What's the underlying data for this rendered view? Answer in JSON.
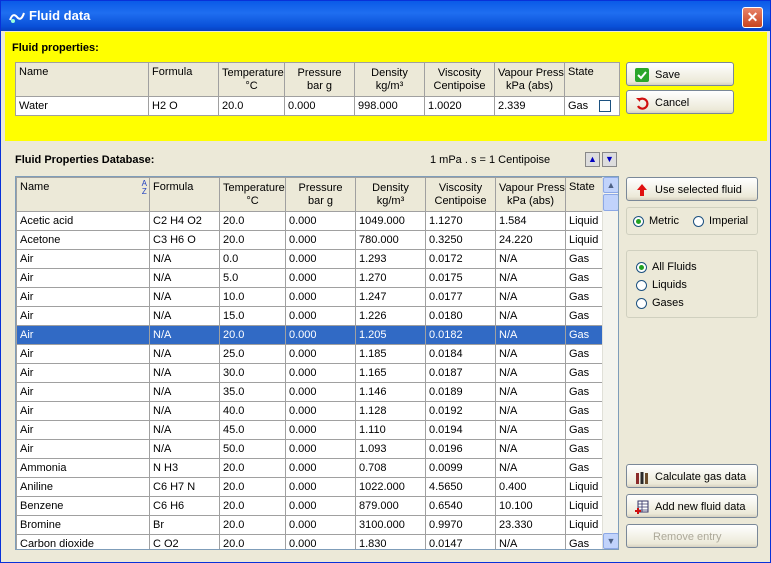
{
  "window": {
    "title": "Fluid data",
    "close_glyph": "✕"
  },
  "fluid_properties": {
    "label": "Fluid properties:",
    "headers": [
      "Name",
      "Formula",
      "Temperature\n°C",
      "Pressure\nbar g",
      "Density\nkg/m³",
      "Viscosity\nCentipoise",
      "Vapour Press.\nkPa (abs)",
      "State"
    ],
    "row": {
      "name": "Water",
      "formula": "H2 O",
      "temperature": "20.0",
      "pressure": "0.000",
      "density": "998.000",
      "viscosity": "1.0020",
      "vapour": "2.339",
      "state": "Gas"
    }
  },
  "buttons": {
    "save": "Save",
    "cancel": "Cancel",
    "use_selected": "Use selected fluid",
    "calculate_gas": "Calculate gas data",
    "add_new": "Add new fluid data",
    "remove": "Remove entry"
  },
  "units": {
    "metric": "Metric",
    "imperial": "Imperial",
    "selected": "Metric"
  },
  "filter": {
    "all": "All Fluids",
    "liquids": "Liquids",
    "gases": "Gases",
    "selected": "All Fluids"
  },
  "database": {
    "label": "Fluid Properties Database:",
    "note": "1 mPa . s = 1 Centipoise",
    "sort_glyph_top": "A",
    "sort_glyph_bottom": "Z",
    "headers": [
      "Name",
      "Formula",
      "Temperature\n°C",
      "Pressure\nbar g",
      "Density\nkg/m³",
      "Viscosity\nCentipoise",
      "Vapour Press.\nkPa (abs)",
      "State"
    ],
    "selected_index": 6,
    "rows": [
      [
        "Acetic acid",
        "C2 H4 O2",
        "20.0",
        "0.000",
        "1049.000",
        "1.1270",
        "1.584",
        "Liquid"
      ],
      [
        "Acetone",
        "C3 H6 O",
        "20.0",
        "0.000",
        "780.000",
        "0.3250",
        "24.220",
        "Liquid"
      ],
      [
        "Air",
        "N/A",
        "0.0",
        "0.000",
        "1.293",
        "0.0172",
        "N/A",
        "Gas"
      ],
      [
        "Air",
        "N/A",
        "5.0",
        "0.000",
        "1.270",
        "0.0175",
        "N/A",
        "Gas"
      ],
      [
        "Air",
        "N/A",
        "10.0",
        "0.000",
        "1.247",
        "0.0177",
        "N/A",
        "Gas"
      ],
      [
        "Air",
        "N/A",
        "15.0",
        "0.000",
        "1.226",
        "0.0180",
        "N/A",
        "Gas"
      ],
      [
        "Air",
        "N/A",
        "20.0",
        "0.000",
        "1.205",
        "0.0182",
        "N/A",
        "Gas"
      ],
      [
        "Air",
        "N/A",
        "25.0",
        "0.000",
        "1.185",
        "0.0184",
        "N/A",
        "Gas"
      ],
      [
        "Air",
        "N/A",
        "30.0",
        "0.000",
        "1.165",
        "0.0187",
        "N/A",
        "Gas"
      ],
      [
        "Air",
        "N/A",
        "35.0",
        "0.000",
        "1.146",
        "0.0189",
        "N/A",
        "Gas"
      ],
      [
        "Air",
        "N/A",
        "40.0",
        "0.000",
        "1.128",
        "0.0192",
        "N/A",
        "Gas"
      ],
      [
        "Air",
        "N/A",
        "45.0",
        "0.000",
        "1.110",
        "0.0194",
        "N/A",
        "Gas"
      ],
      [
        "Air",
        "N/A",
        "50.0",
        "0.000",
        "1.093",
        "0.0196",
        "N/A",
        "Gas"
      ],
      [
        "Ammonia",
        "N H3",
        "20.0",
        "0.000",
        "0.708",
        "0.0099",
        "N/A",
        "Gas"
      ],
      [
        "Aniline",
        "C6 H7 N",
        "20.0",
        "0.000",
        "1022.000",
        "4.5650",
        "0.400",
        "Liquid"
      ],
      [
        "Benzene",
        "C6 H6",
        "20.0",
        "0.000",
        "879.000",
        "0.6540",
        "10.100",
        "Liquid"
      ],
      [
        "Bromine",
        "Br",
        "20.0",
        "0.000",
        "3100.000",
        "0.9970",
        "23.330",
        "Liquid"
      ],
      [
        "Carbon dioxide",
        "C O2",
        "20.0",
        "0.000",
        "1.830",
        "0.0147",
        "N/A",
        "Gas"
      ]
    ]
  },
  "colors": {
    "selection": "#316ac5",
    "panel_highlight": "#ffff00",
    "title_bar": "#0a5ae8"
  }
}
